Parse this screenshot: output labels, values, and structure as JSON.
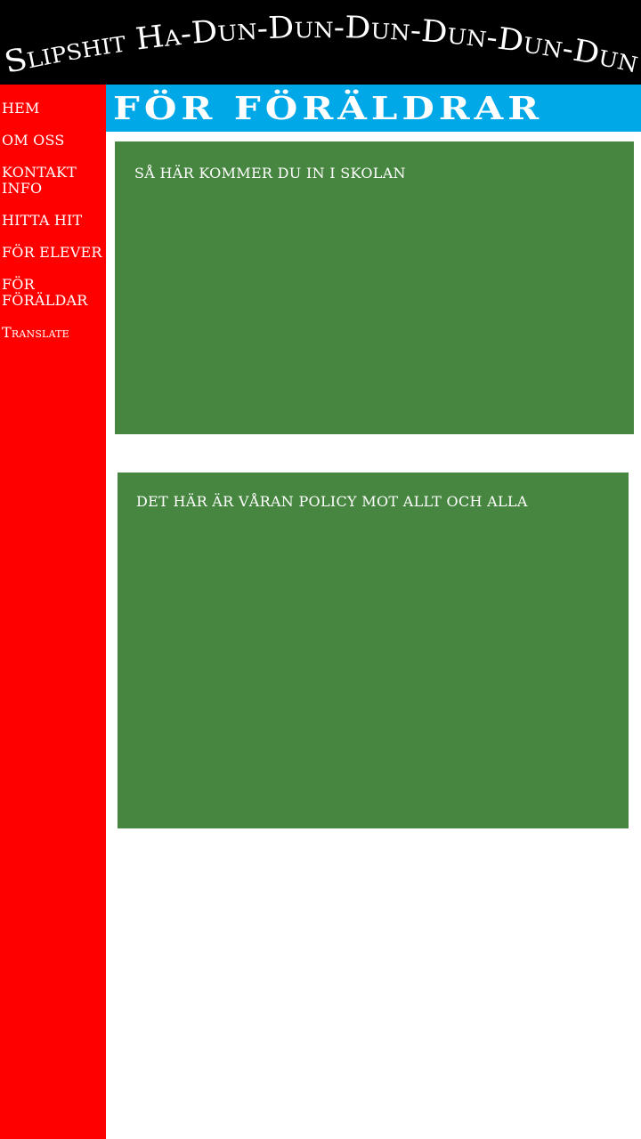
{
  "header": {
    "site_title": "Slipshit Ha-Dun-Dun-Dun-Dun-Dun-Dun"
  },
  "sidebar": {
    "items": [
      {
        "label": "HEM"
      },
      {
        "label": "OM OSS"
      },
      {
        "label": "KONTAKT INFO"
      },
      {
        "label": "HITTA HIT"
      },
      {
        "label": "FÖR ELEVER"
      },
      {
        "label": "FÖR FÖRÄLDAR"
      },
      {
        "label": "Translate"
      }
    ]
  },
  "main": {
    "page_title": "FÖR FÖRÄLDRAR",
    "sections": [
      {
        "heading": "SÅ HÄR KOMMER DU IN I SKOLAN"
      },
      {
        "heading": "DET HÄR ÄR VÅRAN POLICY MOT ALLT OCH ALLA"
      }
    ]
  },
  "colors": {
    "header_bg": "#000000",
    "sidebar_bg": "#ff0000",
    "title_bar_bg": "#00a8e8",
    "content_box_bg": "#478640",
    "text": "#ffffff"
  }
}
